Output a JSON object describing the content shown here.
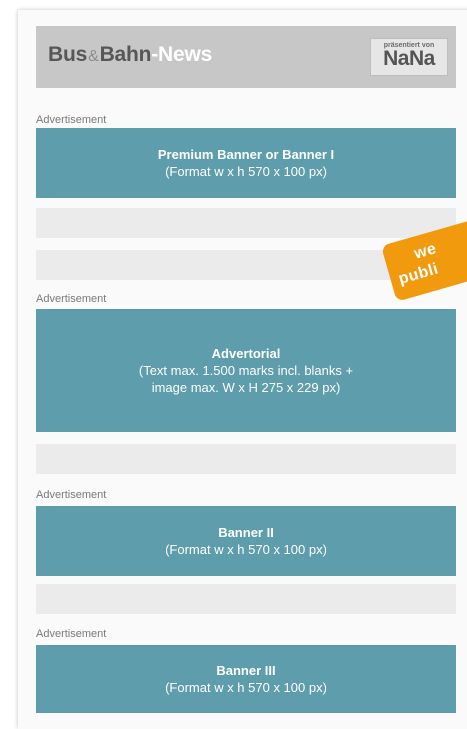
{
  "header": {
    "brand_part1": "Bus",
    "brand_amp": "&",
    "brand_part2": "Bahn",
    "brand_part3": "-News",
    "logo_caption": "präsentiert von",
    "logo_text": "NaNa"
  },
  "ad_label": "Advertisement",
  "banners": [
    {
      "title": "Premium Banner or Banner I",
      "desc": "(Format w x h 570 x 100 px)"
    },
    {
      "title": "Advertorial",
      "desc": "(Text max. 1.500 marks incl. blanks +",
      "desc2": "image max. W x H 275 x 229 px)"
    },
    {
      "title": "Banner II",
      "desc": "(Format w x h 570 x 100 px)"
    },
    {
      "title": "Banner III",
      "desc": "(Format w x h 570 x 100 px)"
    }
  ],
  "ribbon": {
    "line1": "we",
    "line2": "publi"
  },
  "colors": {
    "banner": "#5e9dab",
    "header": "#c7c7c7",
    "ribbon": "#f29a0d",
    "placeholder": "#ebebeb"
  }
}
